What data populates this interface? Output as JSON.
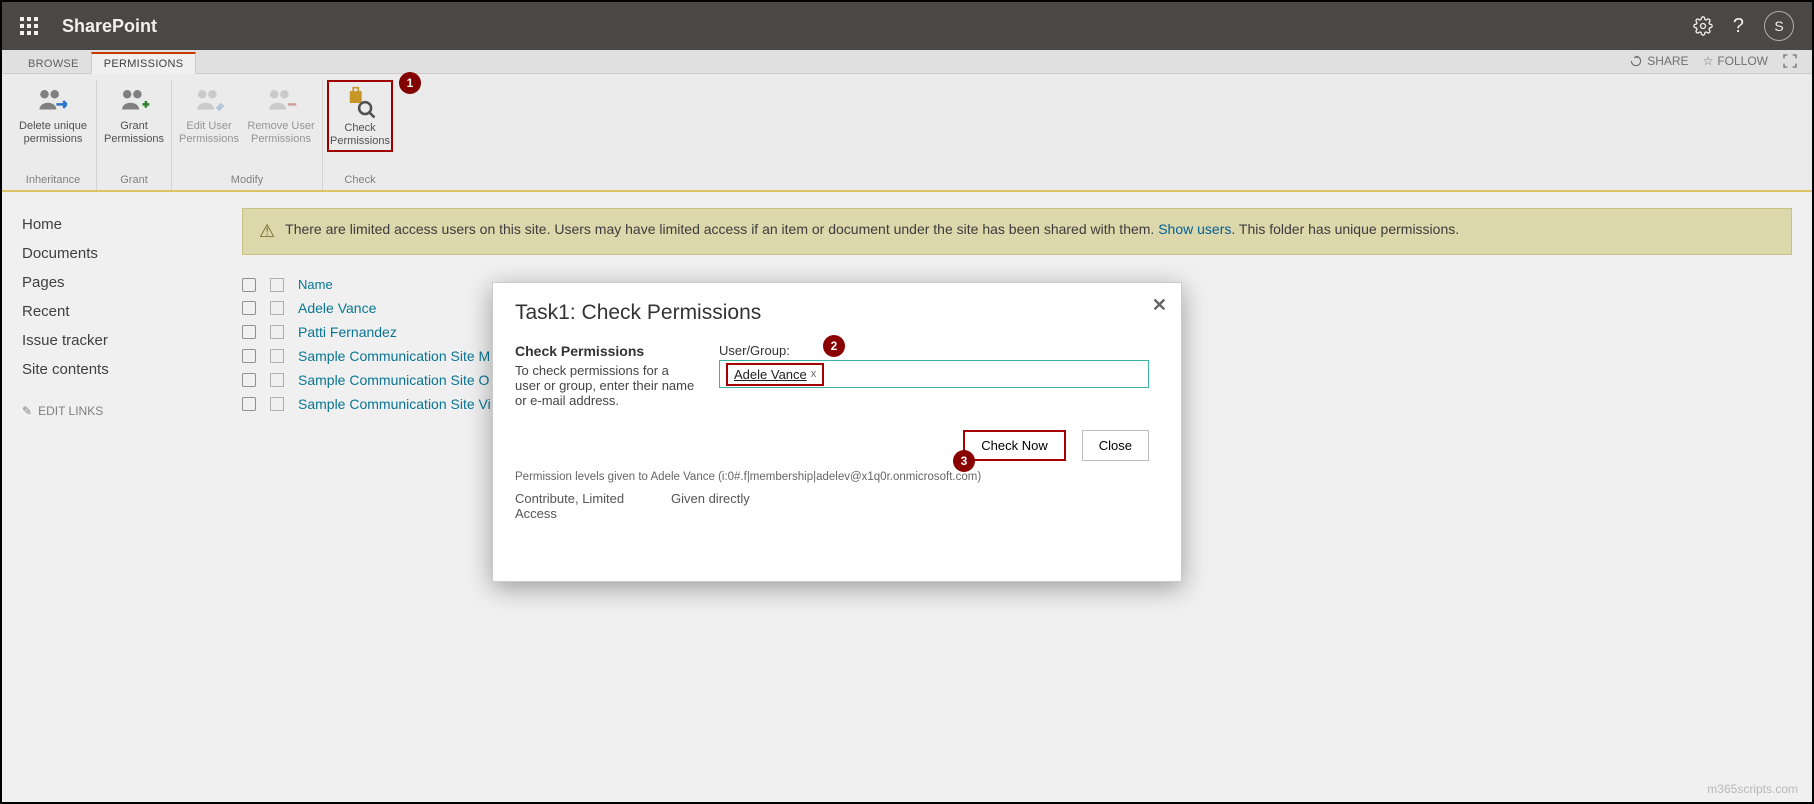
{
  "suite": {
    "app_name": "SharePoint",
    "user_initial": "S"
  },
  "tabs": {
    "browse": "BROWSE",
    "permissions": "PERMISSIONS",
    "right": {
      "share": "SHARE",
      "follow": "FOLLOW"
    }
  },
  "ribbon": {
    "groups": [
      {
        "name": "Inheritance",
        "buttons": [
          {
            "label1": "Delete unique",
            "label2": "permissions"
          }
        ]
      },
      {
        "name": "Grant",
        "buttons": [
          {
            "label1": "Grant",
            "label2": "Permissions"
          }
        ]
      },
      {
        "name": "Modify",
        "buttons": [
          {
            "label1": "Edit User",
            "label2": "Permissions"
          },
          {
            "label1": "Remove User",
            "label2": "Permissions"
          }
        ]
      },
      {
        "name": "Check",
        "buttons": [
          {
            "label1": "Check",
            "label2": "Permissions"
          }
        ]
      }
    ]
  },
  "step_badges": {
    "one": "1",
    "two": "2",
    "three": "3"
  },
  "leftnav": {
    "items": [
      "Home",
      "Documents",
      "Pages",
      "Recent",
      "Issue tracker",
      "Site contents"
    ],
    "edit_links": "EDIT LINKS"
  },
  "notice": {
    "text1": "There are limited access users on this site. Users may have limited access if an item or document under the site has been shared with them. ",
    "link": "Show users",
    "text2": ". This folder has unique permissions."
  },
  "list": {
    "header_name": "Name",
    "rows": [
      "Adele Vance",
      "Patti Fernandez",
      "Sample Communication Site M",
      "Sample Communication Site O",
      "Sample Communication Site Vi"
    ]
  },
  "dialog": {
    "title": "Task1: Check Permissions",
    "section_title": "Check Permissions",
    "section_desc": "To check permissions for a user or group, enter their name or e-mail address.",
    "field_label": "User/Group:",
    "pill_name": "Adele Vance",
    "pill_remove": "x",
    "btn_check": "Check Now",
    "btn_close": "Close",
    "result_header": "Permission levels given to Adele Vance (i:0#.f|membership|adelev@x1q0r.onmicrosoft.com)",
    "result_level": "Contribute, Limited Access",
    "result_given": "Given directly"
  },
  "watermark": "m365scripts.com"
}
